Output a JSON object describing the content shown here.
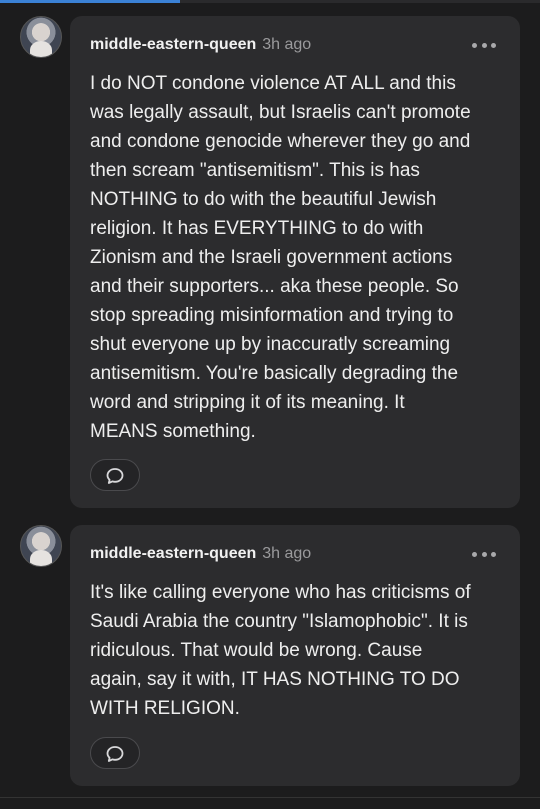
{
  "comments": [
    {
      "username": "middle-eastern-queen",
      "time": "3h ago",
      "text": "I do NOT condone violence AT ALL and this\nwas legally assault, but Israelis can't promote\nand condone genocide wherever they go and\nthen scream \"antisemitism\". This is has\nNOTHING to do with the beautiful Jewish\nreligion. It has EVERYTHING to do with\nZionism and the Israeli government actions\nand their supporters... aka these people. So\nstop spreading misinformation and trying to\nshut everyone up by inaccuratly screaming\nantisemitism. You're basically degrading the\nword and stripping it of its meaning. It\nMEANS something.",
      "reply_icon": "speech-bubble-icon",
      "more_icon": "more-horizontal-icon"
    },
    {
      "username": "middle-eastern-queen",
      "time": "3h ago",
      "text": "It's like calling everyone who has criticisms of\nSaudi Arabia the country \"Islamophobic\". It is\nridiculous. That would be wrong. Cause\nagain, say it with, IT HAS NOTHING TO DO\nWITH RELIGION.",
      "reply_icon": "speech-bubble-icon",
      "more_icon": "more-horizontal-icon"
    }
  ],
  "colors": {
    "background": "#1c1c1d",
    "bubble": "#2c2c2e",
    "accent": "#3b82d6",
    "muted_text": "#9a9a9c"
  }
}
